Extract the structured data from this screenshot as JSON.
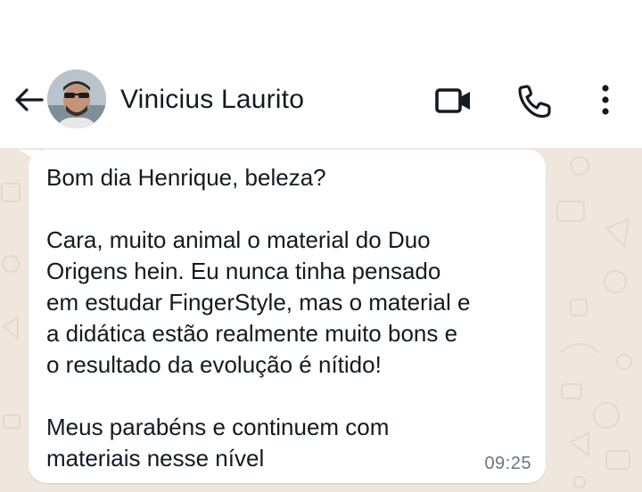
{
  "header": {
    "contact_name": "Vinicius Laurito",
    "icons": {
      "back": "back-arrow-icon",
      "video": "video-call-icon",
      "call": "voice-call-icon",
      "menu": "more-options-icon"
    }
  },
  "message": {
    "line1": "Bom dia Henrique, beleza?",
    "line2a": "Cara, muito animal o material do Duo",
    "line2b": "Origens hein. Eu nunca tinha pensado",
    "line2c": "em estudar FingerStyle, mas o material e",
    "line2d": "a didática estão realmente muito bons e",
    "line2e": "o resultado da evolução é nítido!",
    "line3a": "Meus parabéns e continuem com",
    "line3b": "materiais nesse nível",
    "time": "09:25"
  },
  "colors": {
    "chat_background": "#efe7dd",
    "bubble": "#ffffff",
    "text": "#111b21",
    "timestamp": "#667781"
  }
}
